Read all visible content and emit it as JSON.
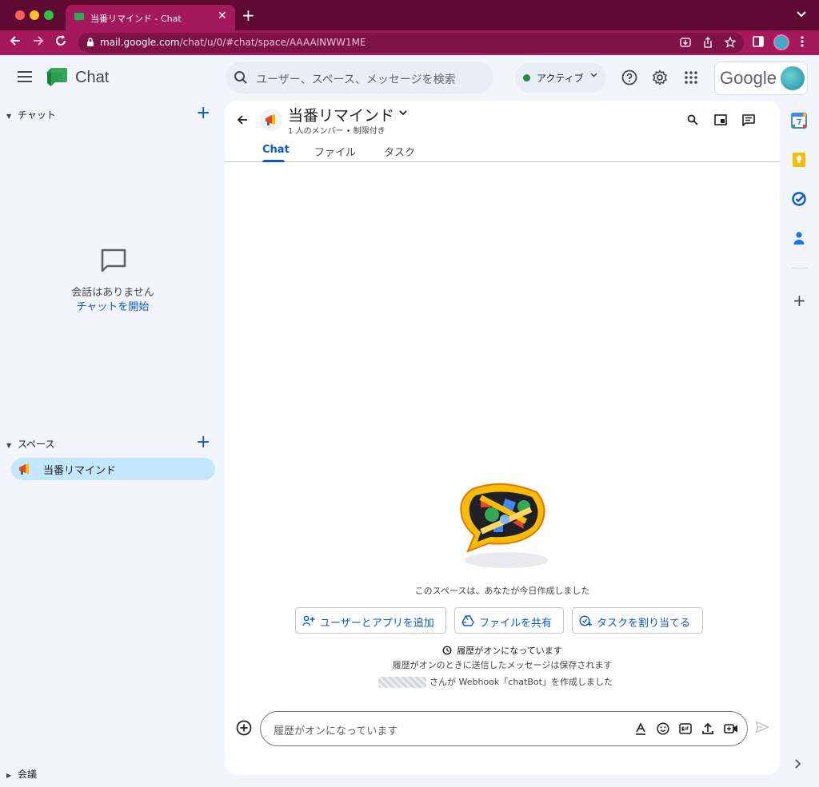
{
  "browser": {
    "tab_title": "当番リマインド - Chat",
    "tab_close": "✕",
    "new_tab": "+",
    "url_host": "mail.google.com",
    "url_path": "/chat/u/0/#chat/space/AAAAINWW1ME"
  },
  "header": {
    "app_name": "Chat",
    "search_placeholder": "ユーザー、スペース、メッセージを検索",
    "status_label": "アクティブ",
    "google_label": "Google"
  },
  "sidebar": {
    "chat_section": "チャット",
    "empty_text": "会話はありません",
    "start_chat_link": "チャットを開始",
    "spaces_section": "スペース",
    "spaces": [
      {
        "label": "当番リマインド"
      }
    ],
    "meetings_section": "会議"
  },
  "space": {
    "title": "当番リマインド",
    "meta": "1 人のメンバー • 制限付き",
    "tabs": [
      "Chat",
      "ファイル",
      "タスク"
    ],
    "active_tab": "Chat"
  },
  "conversation": {
    "created_text": "このスペースは、あなたが今日作成しました",
    "actions": [
      {
        "label": "ユーザーとアプリを追加"
      },
      {
        "label": "ファイルを共有"
      },
      {
        "label": "タスクを割り当てる"
      }
    ],
    "history_title": "履歴がオンになっています",
    "history_sub": "履歴がオンのときに送信したメッセージは保存されます",
    "webhook_text": "さんが Webhook「chatBot」を作成しました"
  },
  "composer": {
    "placeholder": "履歴がオンになっています"
  },
  "colors": {
    "browser_frame": "#a4195c",
    "accent": "#0b57d0",
    "selected_space": "#c2e7ff",
    "status_green": "#1e8e3e"
  }
}
